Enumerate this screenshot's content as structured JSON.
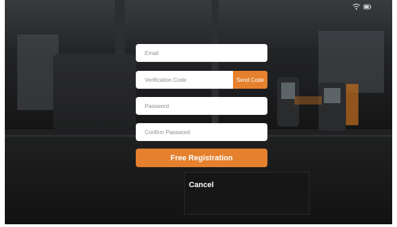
{
  "form": {
    "email_placeholder": "Email",
    "verification_placeholder": "Verification Code",
    "send_code_label": "Send Code",
    "password_placeholder": "Password",
    "confirm_password_placeholder": "Confirm Password",
    "register_label": "Free Registration",
    "cancel_label": "Cancel"
  },
  "colors": {
    "accent": "#e5812e",
    "field_bg": "#ffffff",
    "placeholder": "#8c8c8c"
  },
  "icons": [
    "battery-icon",
    "wifi-icon"
  ]
}
